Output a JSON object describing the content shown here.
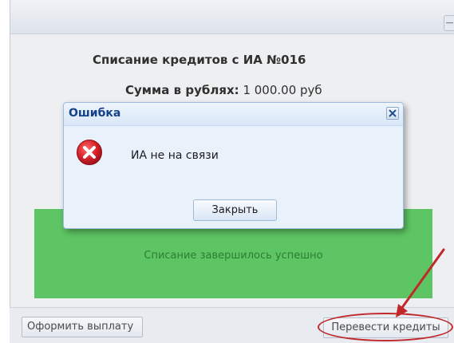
{
  "page": {
    "title": "Списание кредитов с ИА №016",
    "amount_label": "Сумма в рублях:",
    "amount_value": "1 000.00 руб",
    "success_message": "Списание завершилось успешно",
    "collapse_symbol": "−"
  },
  "footer": {
    "pay_button": "Оформить выплату",
    "transfer_button": "Перевести кредиты"
  },
  "dialog": {
    "title": "Ошибка",
    "message": "ИА не на связи",
    "close_button": "Закрыть"
  },
  "colors": {
    "success_background": "#5dc563",
    "annotation": "#c0282a",
    "error_icon": "#d9232b",
    "dialog_title": "#15428b"
  },
  "icons": {
    "dialog_close": "close-icon",
    "error": "error-icon",
    "annotation": "arrow-icon"
  }
}
